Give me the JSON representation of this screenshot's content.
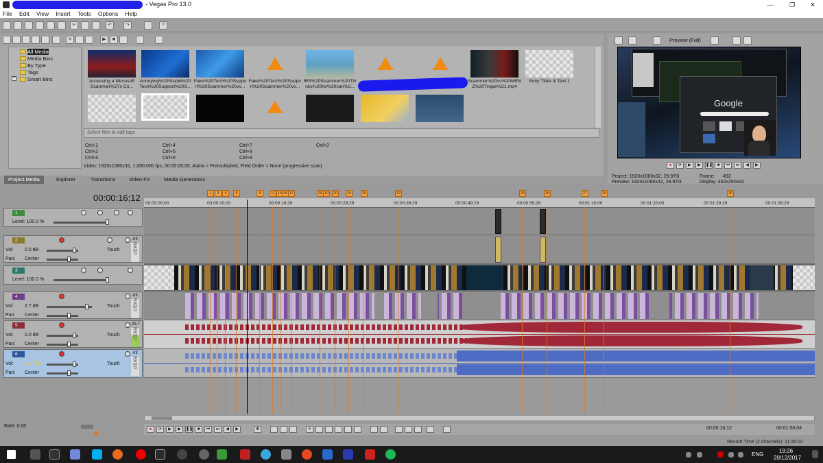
{
  "window": {
    "title": "- Vegas Pro 13.0",
    "min": "—",
    "max": "❐",
    "close": "✕"
  },
  "menu": [
    "File",
    "Edit",
    "View",
    "Insert",
    "Tools",
    "Options",
    "Help"
  ],
  "media_tree": [
    "All Media",
    "Media Bins",
    "By Type",
    "Tags",
    "Smart Bins"
  ],
  "media_items": [
    "Accessing a Microsoft Scammer%27s Co...",
    "Annoying%20Stupid%20 Tech%20Support%20S...",
    "Fake%20Tech%20Suppo rt%20Scammer%20vs...",
    "Fake%20Tech%20Suppo rt%20Scammer%20vs...",
    "IRS%20Scammer%20Thi nks%20he%20can%2...",
    "Scammer%20vs%20MEM Z%20Trojan%21.mp4",
    "Sony Titles & Text 1"
  ],
  "tag_placeholder": "Select files to edit tags",
  "shortcuts": [
    "Ctrl+1",
    "Ctrl+2",
    "Ctrl+3",
    "Ctrl+4",
    "Ctrl+5",
    "Ctrl+6",
    "Ctrl+7",
    "Ctrl+8",
    "Ctrl+9",
    "Ctrl+0"
  ],
  "media_info": "Video: 1920x1080x32, 1,000.000 fps, 00:00:05;00, Alpha = Premultiplied, Field Order = None (progressive scan)",
  "tabs": [
    "Project Media",
    "Explorer",
    "Transitions",
    "Video FX",
    "Media Generators"
  ],
  "preview": {
    "mode": "Preview (Full)",
    "project_label": "Project:",
    "project": "1920x1080x32, 29.970i",
    "preview_label": "Preview:",
    "preview": "1920x1080x32, 29.970i",
    "frame_label": "Frame:",
    "frame": "492",
    "display_label": "Display:",
    "display": "462x260x32",
    "screen_word": "Google"
  },
  "timeline": {
    "timecode": "00:00:16;12",
    "ruler": [
      "00:00:00;00",
      "00:00:10;00",
      "00:00:19;29",
      "00:00:29;29",
      "00:00:39;29",
      "00:00:49;29",
      "00:00:59;28",
      "00:01:10;00",
      "00:01:20;00",
      "00:01:29;29",
      "00:01:39;29"
    ],
    "markers": [
      "1",
      "3",
      "4",
      "5",
      "6",
      "11",
      "14",
      "16",
      "17",
      "18",
      "19",
      "20",
      "24",
      "25",
      "32",
      "26",
      "28",
      "27",
      "29",
      "30"
    ]
  },
  "tracks": [
    {
      "num": "1",
      "type": "video",
      "color": "#3e8a3e",
      "l1": "Level: 100.0 %"
    },
    {
      "num": "2",
      "type": "video",
      "color": "#8a7a2e",
      "l1": "Vol:",
      "v1": "0.0 dB",
      "l2": "Pan:",
      "v2": "Center",
      "touch": "Touch",
      "meter": "-Inf."
    },
    {
      "num": "3",
      "type": "video",
      "color": "#2e7a6e",
      "l1": "Level: 100.0 %"
    },
    {
      "num": "4",
      "type": "audio",
      "color": "#6e3e8a",
      "l1": "Vol:",
      "v1": "2.7 dB",
      "l2": "Pan:",
      "v2": "Center",
      "touch": "Touch",
      "meter": "-Inf."
    },
    {
      "num": "5",
      "type": "audio",
      "color": "#8a2e3a",
      "l1": "Vol:",
      "v1": "0.0 dB",
      "l2": "Pan:",
      "v2": "Center",
      "touch": "Touch",
      "meter": "-25.7"
    },
    {
      "num": "6",
      "type": "audio",
      "color": "#2e5a9a",
      "l1": "Vol:",
      "v1": "MUTED",
      "l2": "Pan:",
      "v2": "Center",
      "touch": "Touch",
      "meter": "-Inf."
    }
  ],
  "meter_ticks": [
    "18",
    "36",
    "54",
    "72"
  ],
  "status": {
    "rate": "Rate: 0.00",
    "cursor_time": "00:00:16;12",
    "end_time": "00:01:50;04",
    "record_time": "Record Time (2 channels): 11:35:10"
  },
  "taskbar": {
    "lang": "ENG",
    "time": "19:26",
    "date": "20/12/2017"
  },
  "colors": {
    "accent_marker": "#f0a040",
    "audio_red": "#a02838",
    "audio_blue": "#3a5ab8",
    "redact": "#1a1aef"
  }
}
